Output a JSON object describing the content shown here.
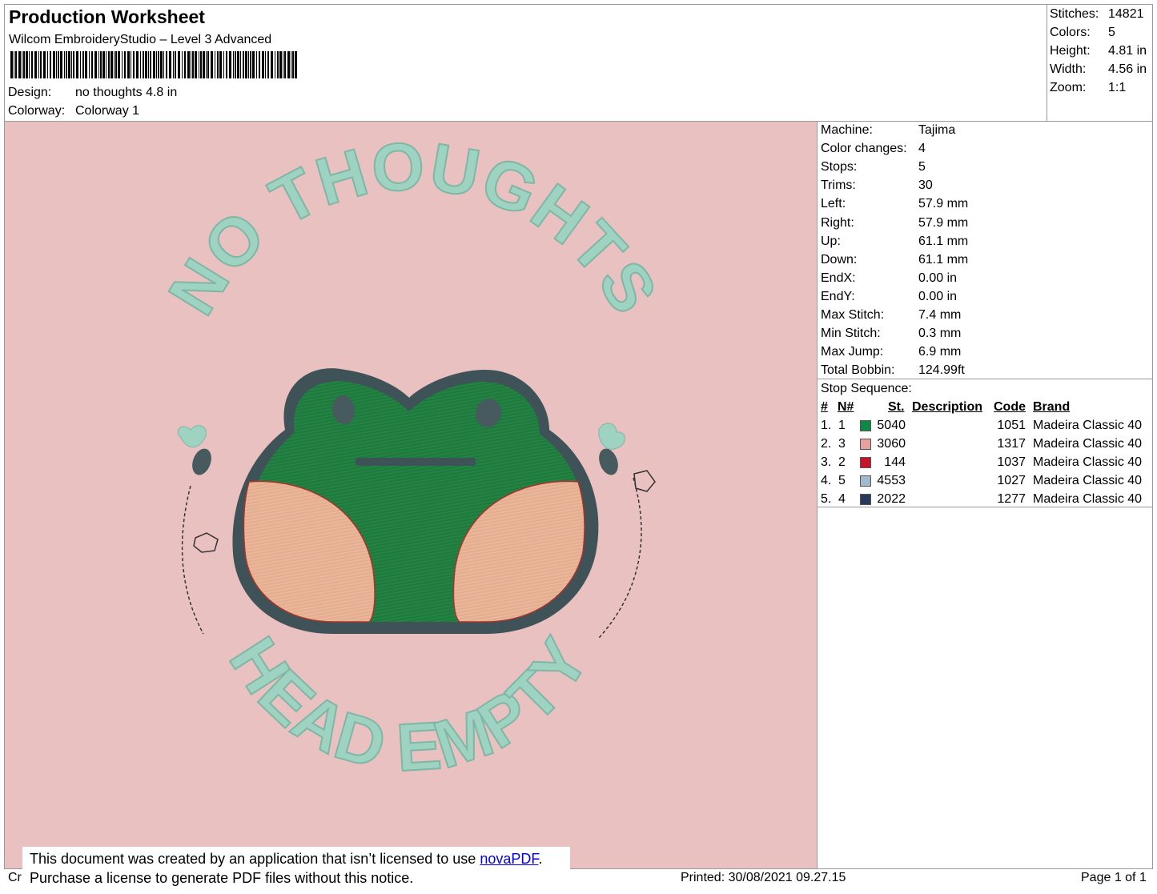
{
  "header": {
    "title": "Production Worksheet",
    "software": "Wilcom EmbroideryStudio – Level 3 Advanced",
    "design_label": "Design:",
    "design_value": "no thoughts 4.8 in",
    "colorway_label": "Colorway:",
    "colorway_value": "Colorway 1"
  },
  "summary": {
    "stitches_label": "Stitches:",
    "stitches_value": "14821",
    "colors_label": "Colors:",
    "colors_value": "5",
    "height_label": "Height:",
    "height_value": "4.81 in",
    "width_label": "Width:",
    "width_value": "4.56 in",
    "zoom_label": "Zoom:",
    "zoom_value": "1:1"
  },
  "info": [
    {
      "label": "Machine:",
      "value": "Tajima"
    },
    {
      "label": "Color changes:",
      "value": "4"
    },
    {
      "label": "Stops:",
      "value": "5"
    },
    {
      "label": "Trims:",
      "value": "30"
    },
    {
      "label": "Left:",
      "value": "57.9 mm"
    },
    {
      "label": "Right:",
      "value": "57.9 mm"
    },
    {
      "label": "Up:",
      "value": "61.1 mm"
    },
    {
      "label": "Down:",
      "value": "61.1 mm"
    },
    {
      "label": "EndX:",
      "value": "0.00 in"
    },
    {
      "label": "EndY:",
      "value": "0.00 in"
    },
    {
      "label": "Max Stitch:",
      "value": "7.4 mm"
    },
    {
      "label": "Min Stitch:",
      "value": "0.3 mm"
    },
    {
      "label": "Max Jump:",
      "value": "6.9 mm"
    },
    {
      "label": "Total Bobbin:",
      "value": "124.99ft"
    }
  ],
  "stop_sequence": {
    "title": "Stop Sequence:",
    "headers": {
      "num": "#",
      "n": "N#",
      "st": "St.",
      "description": "Description",
      "code": "Code",
      "brand": "Brand"
    },
    "rows": [
      {
        "num": "1.",
        "n": "1",
        "st": "5040",
        "description": "",
        "code": "1051",
        "brand": "Madeira Classic 40",
        "color": "#0a8a46"
      },
      {
        "num": "2.",
        "n": "3",
        "st": "3060",
        "description": "",
        "code": "1317",
        "brand": "Madeira Classic 40",
        "color": "#e8a19c"
      },
      {
        "num": "3.",
        "n": "2",
        "st": "144",
        "description": "",
        "code": "1037",
        "brand": "Madeira Classic 40",
        "color": "#c8142a"
      },
      {
        "num": "4.",
        "n": "5",
        "st": "4553",
        "description": "",
        "code": "1027",
        "brand": "Madeira Classic 40",
        "color": "#a0b9cc"
      },
      {
        "num": "5.",
        "n": "4",
        "st": "2022",
        "description": "",
        "code": "1277",
        "brand": "Madeira Classic 40",
        "color": "#283a58"
      }
    ]
  },
  "design_artwork": {
    "top_text": "NO THOUGHTS",
    "bottom_text": "HEAD EMPTY",
    "background_color": "#e9c1c0",
    "text_color": "#9ed3c2",
    "frog_color": "#1f7a3e",
    "cheek_color": "#e5ae90",
    "outline_color": "#3e5258"
  },
  "footer": {
    "notice_line1": "This document was created by an application that isn’t licensed to use ",
    "notice_link": "novaPDF",
    "notice_line1_end": ".",
    "notice_line2": "Purchase a license to generate PDF files without this notice.",
    "created_prefix": "Cr",
    "printed": "Printed: 30/08/2021 09.27.15",
    "page": "Page 1 of 1"
  }
}
